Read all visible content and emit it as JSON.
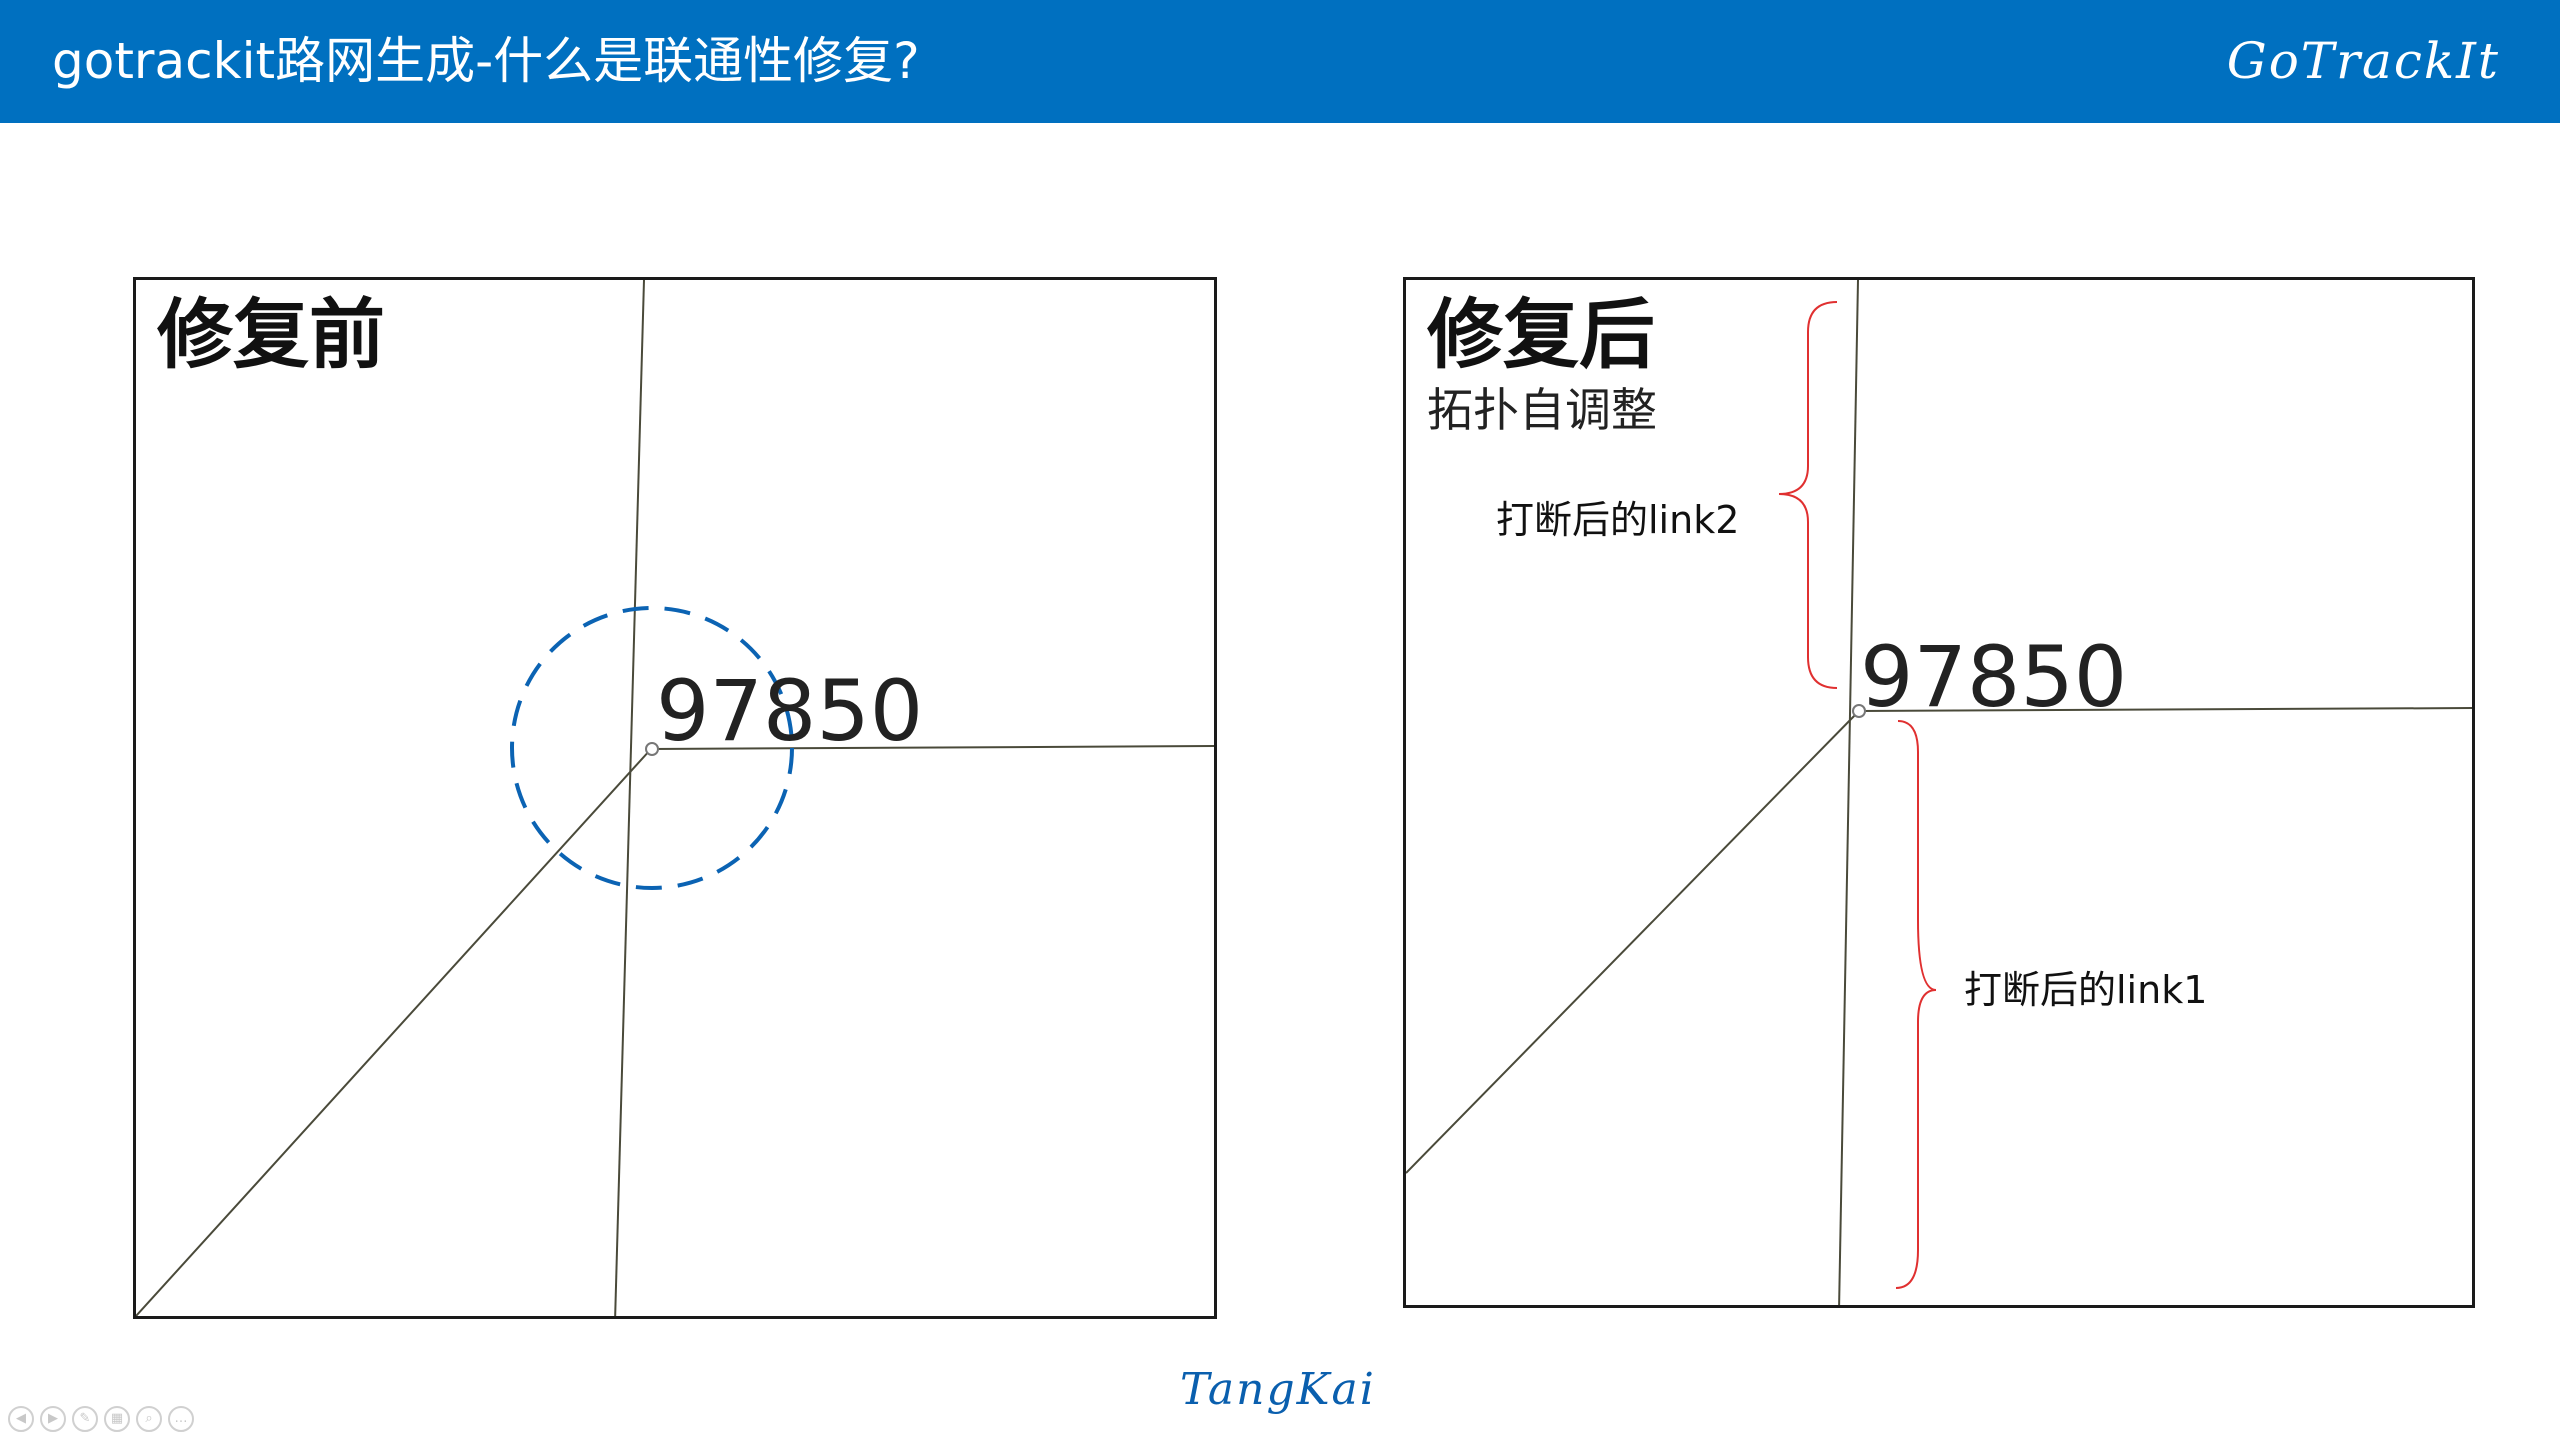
{
  "header": {
    "title": "gotrackit路网生成-什么是联通性修复?",
    "brand": "GoTrackIt"
  },
  "panel_before": {
    "title": "修复前",
    "node_id": "97850"
  },
  "panel_after": {
    "title": "修复后",
    "subtitle": "拓扑自调整",
    "node_id": "97850",
    "link2_label": "打断后的link2",
    "link1_label": "打断后的link1"
  },
  "footer": {
    "signature": "TangKai"
  },
  "slide_controls": [
    {
      "name": "prev-slide-icon",
      "glyph": "◀"
    },
    {
      "name": "next-slide-icon",
      "glyph": "▶"
    },
    {
      "name": "pen-icon",
      "glyph": "✎"
    },
    {
      "name": "slides-grid-icon",
      "glyph": "▦"
    },
    {
      "name": "zoom-icon",
      "glyph": "⌕"
    },
    {
      "name": "more-options-icon",
      "glyph": "…"
    }
  ],
  "colors": {
    "header_bg": "#0070c0",
    "road_line": "#4a4a3a",
    "highlight_circle": "#0b63b3",
    "brace": "#e03030",
    "signature": "#0a5fae"
  }
}
